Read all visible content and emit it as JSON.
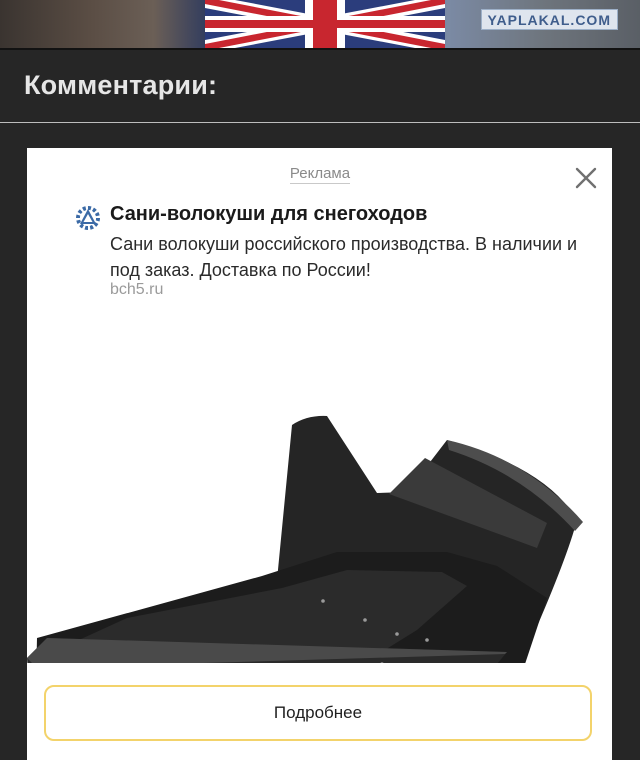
{
  "header": {
    "site_logo": "YAPLAKAL.COM",
    "section_title": "Комментарии:"
  },
  "ad": {
    "label": "Реклама",
    "title": "Сани-волокуши для снегоходов",
    "description": "Сани волокуши российского производства. В наличии и под заказ. Доставка по России!",
    "domain": "bch5.ru",
    "cta_label": "Подробнее",
    "icons": {
      "close": "close-icon",
      "favicon": "gear-triangle-icon",
      "image": "sled-photo"
    }
  },
  "colors": {
    "page_background": "#262626",
    "section_title": "#e6e6e6",
    "cta_border": "#f3d36b",
    "ad_background": "#ffffff"
  }
}
